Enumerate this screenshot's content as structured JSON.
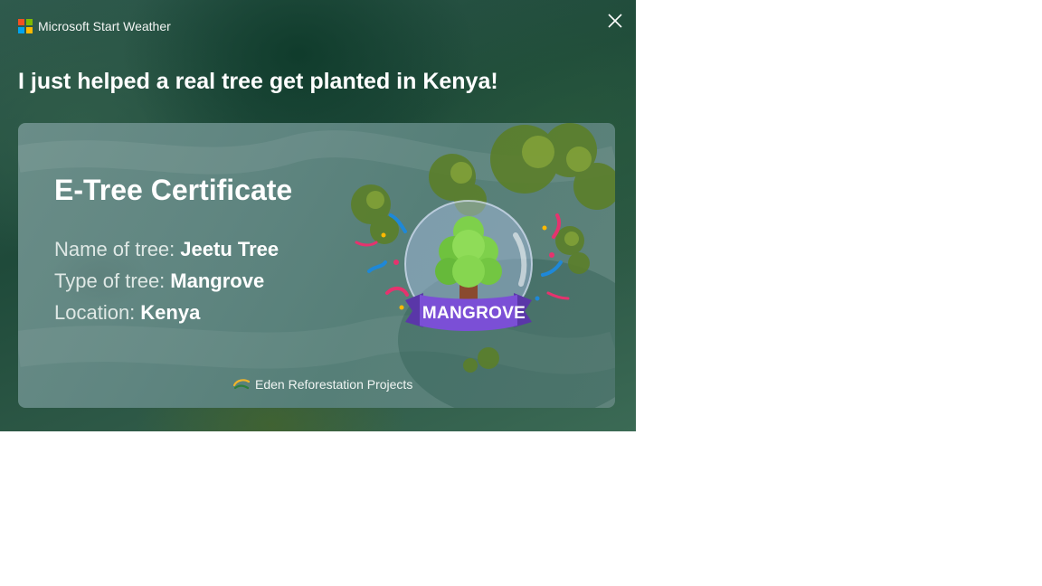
{
  "app": {
    "name": "Microsoft Start Weather",
    "logo_colors": [
      "#f25022",
      "#7fba00",
      "#00a4ef",
      "#ffb900"
    ]
  },
  "window": {
    "close_icon": "close-icon"
  },
  "headline": "I just helped a real tree get planted in Kenya!",
  "certificate": {
    "title": "E-Tree Certificate",
    "fields": [
      {
        "label": "Name of tree:",
        "value": "Jeetu Tree"
      },
      {
        "label": "Type of tree:",
        "value": "Mangrove"
      },
      {
        "label": "Location:",
        "value": "Kenya"
      }
    ],
    "badge_label": "MANGROVE",
    "badge_colors": {
      "ribbon": "#7b4fd6",
      "tree": "#7ed04b",
      "trunk": "#8a4a2f",
      "bubble": "#9fb6e0"
    },
    "partner": "Eden Reforestation Projects"
  }
}
